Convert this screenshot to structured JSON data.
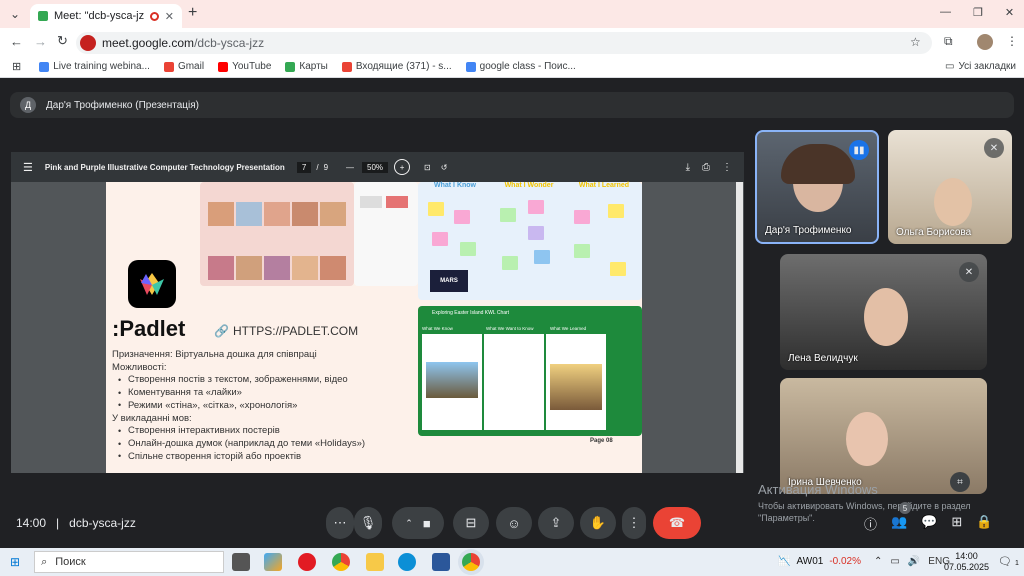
{
  "browser": {
    "tab_title": "Meet: \"dcb-ysca-jzz\"",
    "url_domain": "meet.google.com",
    "url_path": "/dcb-ysca-jzz",
    "bookmarks": [
      {
        "label": "Live training webina...",
        "color": "#4285f4"
      },
      {
        "label": "Gmail",
        "color": "#ea4335"
      },
      {
        "label": "YouTube",
        "color": "#ff0000"
      },
      {
        "label": "Карты",
        "color": "#34a853"
      },
      {
        "label": "Входящие (371) - s...",
        "color": "#ea4335"
      },
      {
        "label": "google class - Поис...",
        "color": "#4285f4"
      }
    ],
    "all_bookmarks": "Усі закладки"
  },
  "meet": {
    "presenter_initial": "Д",
    "presenter_label": "Дар'я Трофименко (Презентація)",
    "time": "14:00",
    "meeting_code": "dcb-ysca-jzz",
    "participant_count": "5",
    "participants": [
      {
        "name": "Дар'я Трофименко",
        "speaking": true
      },
      {
        "name": "Ольга Борисова",
        "muted": true
      },
      {
        "name": "Лена Велидчук",
        "muted": true
      },
      {
        "name": "Ірина Шевченко"
      }
    ],
    "windows_watermark_title": "Активация Windows",
    "windows_watermark_text": "Чтобы активировать Windows, перейдите в раздел \"Параметры\"."
  },
  "pdf": {
    "title": "Pink and Purple Illustrative Computer Technology Presentation",
    "page_current": "7",
    "page_sep": "/",
    "page_total": "9",
    "zoom": "50%"
  },
  "slide": {
    "padlet_logo_text": ":Padlet",
    "url": "HTTPS://PADLET.COM",
    "purpose": "Призначення: Віртуальна дошка для співпраці",
    "features_title": "Можливості:",
    "features": [
      "Створення постів з текстом, зображеннями, відео",
      "Коментування та «лайки»",
      "Режими «стіна», «сітка», «хронологія»"
    ],
    "teaching_title": "У викладанні мов:",
    "teaching": [
      "Створення інтерактивних постерів",
      "Онлайн-дошка думок (наприклад до теми «Holidays»)",
      "Спільне створення історій або проектів"
    ],
    "kwl_headers": [
      "What I Know",
      "What I Wonder",
      "What I Learned"
    ],
    "green_board_title": "Exploring Easter Island KWL Chart",
    "green_board_cols": [
      "What We Know",
      "What We Want to Know",
      "What We Learned"
    ],
    "page_label": "Page 08",
    "mars_label": "MARS"
  },
  "taskbar": {
    "search": "Поиск",
    "stock_name": "AW01",
    "stock_change": "-0.02%",
    "lang": "ENG",
    "clock_time": "14:00",
    "clock_date": "07.05.2025",
    "notif_count": "1"
  },
  "colors": {
    "end_call": "#ea4335",
    "tab_strip": "#fce8e6",
    "kwl_blue": "#4a9fd8",
    "kwl_yellow": "#f2c400",
    "padlet_green": "#1e8a3c"
  }
}
